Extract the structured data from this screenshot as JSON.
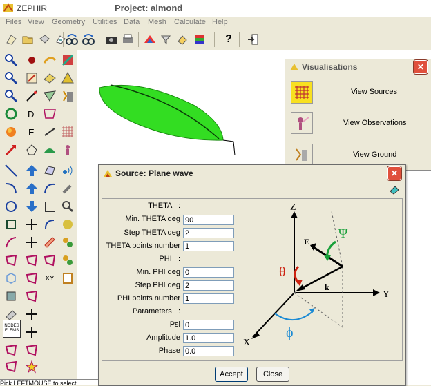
{
  "app": {
    "name": "ZEPHIR",
    "project": "Project: almond"
  },
  "menu": [
    "Files",
    "View",
    "Geometry",
    "Utilities",
    "Data",
    "Mesh",
    "Calculate",
    "Help"
  ],
  "toolbar": {
    "help_glyph": "?"
  },
  "visualisations": {
    "title": "Visualisations",
    "close": "✕",
    "items": [
      {
        "label": "View Sources"
      },
      {
        "label": "View Observations"
      },
      {
        "label": "View Ground"
      }
    ]
  },
  "dialog": {
    "title": "Source: Plane wave",
    "close": "✕",
    "sections": {
      "theta": "THETA",
      "phi": "PHI",
      "parameters": "Parameters",
      "colon": ":"
    },
    "fields": [
      {
        "label": "Min. THETA deg",
        "value": "90"
      },
      {
        "label": "Step THETA deg",
        "value": "2"
      },
      {
        "label": "THETA points number",
        "value": "1"
      },
      {
        "label": "Min. PHI deg",
        "value": "0"
      },
      {
        "label": "Step PHI deg",
        "value": "2"
      },
      {
        "label": "PHI points number",
        "value": "1"
      },
      {
        "label": "Psi",
        "value": "0"
      },
      {
        "label": "Amplitude",
        "value": "1.0"
      },
      {
        "label": "Phase",
        "value": "0.0"
      }
    ],
    "accept": "Accept",
    "close_button": "Close",
    "diagram": {
      "z": "Z",
      "y": "Y",
      "x": "X",
      "e": "E",
      "k": "k",
      "psi": "Ψ",
      "theta": "θ",
      "phi": "ϕ"
    }
  },
  "palette": {
    "xy_label": "XY",
    "nodes_label_1": "NODES",
    "nodes_label_2": "ELEMS"
  },
  "status": {
    "text": "Pick LEFTMOUSE to select"
  },
  "colors": {
    "almond_fill": "#33dd22",
    "accent_red": "#cc2211",
    "accent_blue": "#1a8ad4",
    "accent_green": "#19a03a"
  }
}
